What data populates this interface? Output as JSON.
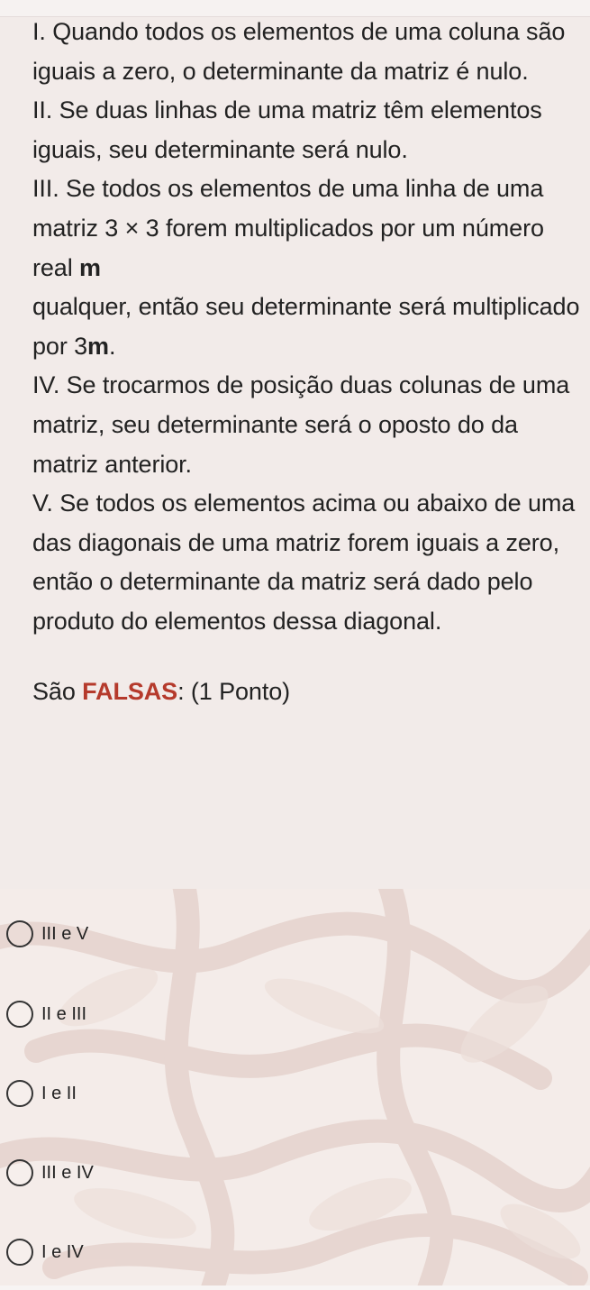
{
  "question": {
    "statements": [
      "I. Quando todos os elementos de uma coluna são iguais a zero, o determinante da matriz é nulo.",
      "II. Se duas linhas de uma matriz têm elementos iguais, seu determinante será nulo.",
      "III. Se todos os elementos de uma linha de uma matriz 3 × 3 forem multiplicados por um número real",
      "m",
      "qualquer, então seu determinante será multiplicado por 3",
      "m",
      ".",
      "IV. Se trocarmos de posição duas colunas de uma matriz, seu determinante será o oposto do da matriz anterior.",
      "V. Se todos os elementos acima ou abaixo de uma das diagonais de uma matriz forem iguais a zero, então o determinante da matriz será dado pelo produto do elementos dessa diagonal."
    ],
    "prompt_start": "São ",
    "prompt_emph": "FALSAS",
    "prompt_end": ": (1 Ponto)"
  },
  "options": [
    {
      "label": "III e V"
    },
    {
      "label": "II e III"
    },
    {
      "label": "I e II"
    },
    {
      "label": "III e IV"
    },
    {
      "label": "I e IV"
    }
  ],
  "colors": {
    "emphasis": "#b53a2c",
    "background": "#f2ebe9",
    "pattern": "#e3cfc9"
  }
}
